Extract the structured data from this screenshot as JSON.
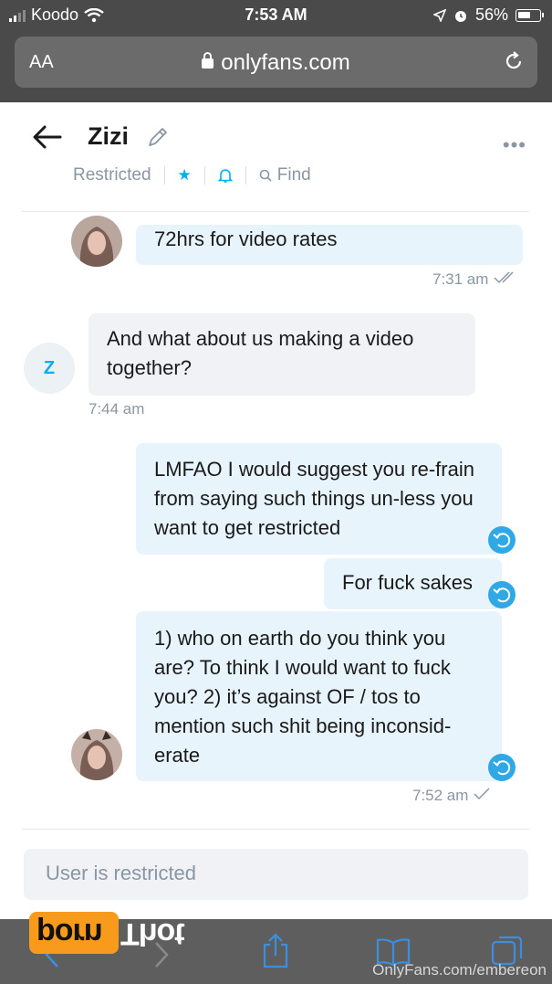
{
  "status_bar": {
    "carrier": "Koodo",
    "time": "7:53 AM",
    "battery": "56%"
  },
  "browser": {
    "aa_label": "AA",
    "url": "onlyfans.com"
  },
  "chat": {
    "contact_name": "Zizi",
    "restricted_label": "Restricted",
    "find_label": "Find",
    "more_label": "•••"
  },
  "messages": [
    {
      "sender": "Zizi",
      "text": "72hrs for video rates",
      "time": "7:31 am"
    },
    {
      "sender": "Z",
      "avatar_letter": "Z",
      "text": "And what about us making a video together?",
      "time": "7:44 am"
    },
    {
      "sender": "Zizi",
      "text": "LMFAO I would suggest you re-frain from saying such things un-less you want to get restricted"
    },
    {
      "sender": "Zizi",
      "text": "For fuck sakes"
    },
    {
      "sender": "Zizi",
      "text": "1) who on earth do you think you are? To think I would want to fuck you? 2) it’s against OF / tos to mention such shit being inconsid-erate",
      "time": "7:52 am"
    }
  ],
  "input": {
    "placeholder": "User is restricted"
  },
  "overlay": {
    "logo_part1": "porn",
    "logo_part2": "Thot",
    "watermark": "OnlyFans.com/embereon"
  },
  "colors": {
    "accent": "#00aff0",
    "incoming_bubble": "#e8f4fb",
    "outgoing_bubble": "#f0f2f5",
    "logo_orange": "#f89b1c"
  }
}
